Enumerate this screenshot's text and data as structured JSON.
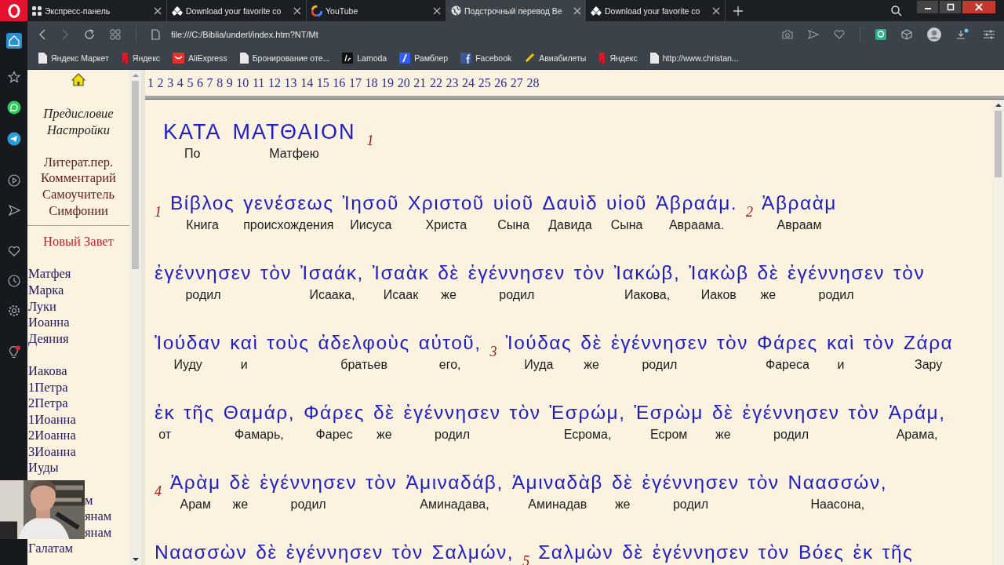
{
  "browser": {
    "tabs": [
      {
        "title": "Экспресс-панель",
        "selected": false
      },
      {
        "title": "Download your favorite co",
        "selected": false
      },
      {
        "title": "YouTube",
        "selected": false
      },
      {
        "title": "Подстрочный перевод Be",
        "selected": true
      },
      {
        "title": "Download your favorite co",
        "selected": false
      }
    ],
    "address": "file:///C:/Biblia/underl/index.htm?NT/Mt",
    "bookmarks": [
      {
        "label": "Яндекс Маркет"
      },
      {
        "label": "Яндекс"
      },
      {
        "label": "AliExpress"
      },
      {
        "label": "Бронирование оте..."
      },
      {
        "label": "Lamoda"
      },
      {
        "label": "Рамблер"
      },
      {
        "label": "Facebook"
      },
      {
        "label": "Авиабилеты"
      },
      {
        "label": "Яндекс"
      },
      {
        "label": "http://www.christan..."
      }
    ]
  },
  "nav": {
    "intro": [
      "Предисловие",
      "Настройки"
    ],
    "tools": [
      "Литерат.пер.",
      "Комментарий",
      "Самоучитель",
      "Симфонии"
    ],
    "testament": "Новый Завет",
    "books": [
      [
        "Матфея",
        "Марка",
        "Луки",
        "Иоанна",
        "Деяния"
      ],
      [
        "Иакова",
        "1Петра",
        "2Петра",
        "1Иоанна",
        "2Иоанна",
        "3Иоанна",
        "Иуды"
      ]
    ],
    "covered_books": [
      "м",
      "янам",
      "янам",
      "Галатам"
    ]
  },
  "chapters": [
    "1",
    "2",
    "3",
    "4",
    "5",
    "6",
    "7",
    "8",
    "9",
    "10",
    "11",
    "12",
    "13",
    "14",
    "15",
    "16",
    "17",
    "18",
    "19",
    "20",
    "21",
    "22",
    "23",
    "24",
    "25",
    "26",
    "27",
    "28"
  ],
  "text": {
    "lines": [
      [
        {
          "kind": "title",
          "greek": "ΚΑΤΑ",
          "russian": "По"
        },
        {
          "kind": "title",
          "greek": "ΜΑΤΘΑΙΟΝ",
          "russian": "Матфею"
        },
        {
          "kind": "verse",
          "num": "1"
        }
      ],
      [
        {
          "kind": "verse",
          "num": "1"
        },
        {
          "kind": "word",
          "greek": "Βίβλος",
          "russian": "Книга"
        },
        {
          "kind": "word",
          "greek": "γενέσεως",
          "russian": "происхождения"
        },
        {
          "kind": "word",
          "greek": "Ἰησοῦ",
          "russian": "Иисуса"
        },
        {
          "kind": "word",
          "greek": "Χριστοῦ",
          "russian": "Христа"
        },
        {
          "kind": "word",
          "greek": "υἱοῦ",
          "russian": "Сына"
        },
        {
          "kind": "word",
          "greek": "Δαυὶδ",
          "russian": "Давида"
        },
        {
          "kind": "word",
          "greek": "υἱοῦ",
          "russian": "Сына"
        },
        {
          "kind": "word",
          "greek": "Ἀβραάμ.",
          "russian": "Авраама."
        },
        {
          "kind": "verse",
          "num": "2"
        },
        {
          "kind": "word",
          "greek": "Ἀβραὰμ",
          "russian": "Авраам"
        }
      ],
      [
        {
          "kind": "word",
          "greek": "ἐγέννησεν",
          "russian": "родил"
        },
        {
          "kind": "word",
          "greek": "τὸν"
        },
        {
          "kind": "word",
          "greek": "Ἰσαάκ,",
          "russian": "Исаака,"
        },
        {
          "kind": "word",
          "greek": "Ἰσαὰκ",
          "russian": "Исаак"
        },
        {
          "kind": "word",
          "greek": "δὲ",
          "russian": "же"
        },
        {
          "kind": "word",
          "greek": "ἐγέννησεν",
          "russian": "родил"
        },
        {
          "kind": "word",
          "greek": "τὸν"
        },
        {
          "kind": "word",
          "greek": "Ἰακώβ,",
          "russian": "Иакова,"
        },
        {
          "kind": "word",
          "greek": "Ἰακὼβ",
          "russian": "Иаков"
        },
        {
          "kind": "word",
          "greek": "δὲ",
          "russian": "же"
        },
        {
          "kind": "word",
          "greek": "ἐγέννησεν",
          "russian": "родил"
        },
        {
          "kind": "word",
          "greek": "τὸν"
        }
      ],
      [
        {
          "kind": "word",
          "greek": "Ἰούδαν",
          "russian": "Иуду"
        },
        {
          "kind": "word",
          "greek": "καὶ",
          "russian": "и"
        },
        {
          "kind": "word",
          "greek": "τοὺς"
        },
        {
          "kind": "word",
          "greek": "ἀδελφοὺς",
          "russian": "братьев"
        },
        {
          "kind": "word",
          "greek": "αὐτοῦ,",
          "russian": "его,"
        },
        {
          "kind": "verse",
          "num": "3"
        },
        {
          "kind": "word",
          "greek": "Ἰούδας",
          "russian": "Иуда"
        },
        {
          "kind": "word",
          "greek": "δὲ",
          "russian": "же"
        },
        {
          "kind": "word",
          "greek": "ἐγέννησεν",
          "russian": "родил"
        },
        {
          "kind": "word",
          "greek": "τὸν"
        },
        {
          "kind": "word",
          "greek": "Φάρες",
          "russian": "Фареса"
        },
        {
          "kind": "word",
          "greek": "καὶ",
          "russian": "и"
        },
        {
          "kind": "word",
          "greek": "τὸν"
        },
        {
          "kind": "word",
          "greek": "Ζάρα",
          "russian": "Зару"
        }
      ],
      [
        {
          "kind": "word",
          "greek": "ἐκ",
          "russian": "от"
        },
        {
          "kind": "word",
          "greek": "τῆς"
        },
        {
          "kind": "word",
          "greek": "Θαμάρ,",
          "russian": "Фамарь,"
        },
        {
          "kind": "word",
          "greek": "Φάρες",
          "russian": "Фарес"
        },
        {
          "kind": "word",
          "greek": "δὲ",
          "russian": "же"
        },
        {
          "kind": "word",
          "greek": "ἐγέννησεν",
          "russian": "родил"
        },
        {
          "kind": "word",
          "greek": "τὸν"
        },
        {
          "kind": "word",
          "greek": "Ἑσρώμ,",
          "russian": "Есрома,"
        },
        {
          "kind": "word",
          "greek": "Ἑσρὼμ",
          "russian": "Есром"
        },
        {
          "kind": "word",
          "greek": "δὲ",
          "russian": "же"
        },
        {
          "kind": "word",
          "greek": "ἐγέννησεν",
          "russian": "родил"
        },
        {
          "kind": "word",
          "greek": "τὸν"
        },
        {
          "kind": "word",
          "greek": "Ἀράμ,",
          "russian": "Арама,"
        }
      ],
      [
        {
          "kind": "verse",
          "num": "4"
        },
        {
          "kind": "word",
          "greek": "Ἀρὰμ",
          "russian": "Арам"
        },
        {
          "kind": "word",
          "greek": "δὲ",
          "russian": "же"
        },
        {
          "kind": "word",
          "greek": "ἐγέννησεν",
          "russian": "родил"
        },
        {
          "kind": "word",
          "greek": "τὸν"
        },
        {
          "kind": "word",
          "greek": "Ἀμιναδάβ,",
          "russian": "Аминадава,"
        },
        {
          "kind": "word",
          "greek": "Ἀμιναδὰβ",
          "russian": "Аминадав"
        },
        {
          "kind": "word",
          "greek": "δὲ",
          "russian": "же"
        },
        {
          "kind": "word",
          "greek": "ἐγέννησεν",
          "russian": "родил"
        },
        {
          "kind": "word",
          "greek": "τὸν"
        },
        {
          "kind": "word",
          "greek": "Ναασσών,",
          "russian": "Наасона,"
        }
      ],
      [
        {
          "kind": "word",
          "greek": "Ναασσὼν"
        },
        {
          "kind": "word",
          "greek": "δὲ"
        },
        {
          "kind": "word",
          "greek": "ἐγέννησεν"
        },
        {
          "kind": "word",
          "greek": "τὸν"
        },
        {
          "kind": "word",
          "greek": "Σαλμών,"
        },
        {
          "kind": "verse",
          "num": "5"
        },
        {
          "kind": "word",
          "greek": "Σαλμὼν"
        },
        {
          "kind": "word",
          "greek": "δὲ"
        },
        {
          "kind": "word",
          "greek": "ἐγέννησεν"
        },
        {
          "kind": "word",
          "greek": "τὸν"
        },
        {
          "kind": "word",
          "greek": "Βόες"
        },
        {
          "kind": "word",
          "greek": "ἐκ"
        },
        {
          "kind": "word",
          "greek": "τῆς"
        }
      ]
    ]
  }
}
